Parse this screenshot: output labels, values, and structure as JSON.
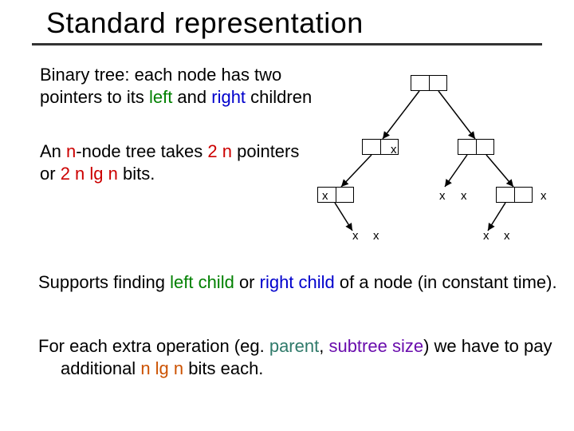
{
  "title": "Standard representation",
  "para1": {
    "t1": "Binary tree: each node has two pointers to its ",
    "left": "left",
    "t2": " and ",
    "right": "right",
    "t3": " children"
  },
  "para2": {
    "t1": "An ",
    "n": "n",
    "t2": "-node tree takes ",
    "p1": "2 n",
    "t3": " pointers or ",
    "p2": "2 n lg n",
    "t4": " bits."
  },
  "para3": {
    "t1": "Supports finding ",
    "lc": "left child",
    "t2": " or ",
    "rc": "right child",
    "t3": " of a node (in constant time)."
  },
  "para4": {
    "t1": "For each extra operation (eg. ",
    "parent": "parent",
    "t2": ", ",
    "ss": "subtree size",
    "t3": ") we have to pay additional ",
    "cost": "n lg n",
    "t4": " bits each."
  },
  "x": "x"
}
